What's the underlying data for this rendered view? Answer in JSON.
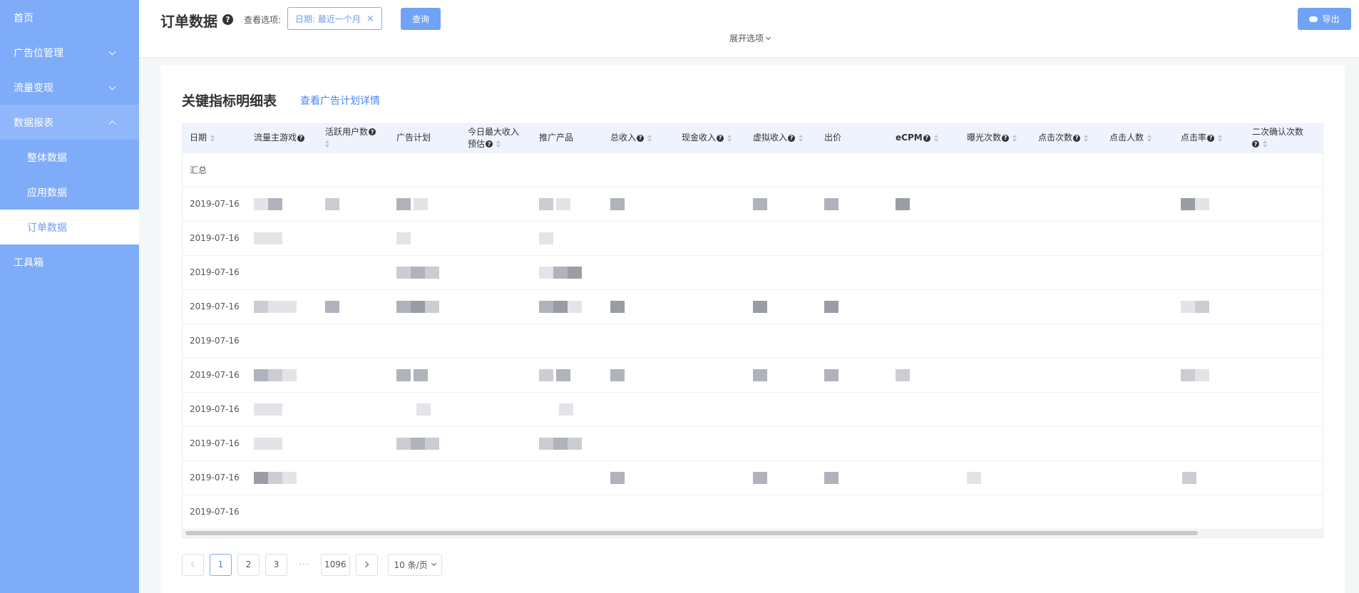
{
  "sidebar": {
    "items": [
      {
        "label": "首页"
      },
      {
        "label": "广告位管理"
      },
      {
        "label": "流量变现"
      },
      {
        "label": "数据报表"
      },
      {
        "label": "整体数据"
      },
      {
        "label": "应用数据"
      },
      {
        "label": "订单数据"
      },
      {
        "label": "工具箱"
      }
    ]
  },
  "header": {
    "title": "订单数据",
    "view_label": "查看选项:",
    "filter_tag": "日期: 最近一个月",
    "query_label": "查询",
    "expand_label": "展开选项",
    "export_label": "导出"
  },
  "card": {
    "title": "关键指标明细表",
    "detail_link": "查看广告计划详情"
  },
  "table": {
    "columns": [
      {
        "label": "日期"
      },
      {
        "label": "流量主游戏"
      },
      {
        "label": "活跃用户数"
      },
      {
        "label": "广告计划"
      },
      {
        "label": "今日最大收入预估"
      },
      {
        "label": "推广产品"
      },
      {
        "label": "总收入"
      },
      {
        "label": "现金收入"
      },
      {
        "label": "虚拟收入"
      },
      {
        "label": "出价"
      },
      {
        "label": "eCPM"
      },
      {
        "label": "曝光次数"
      },
      {
        "label": "点击次数"
      },
      {
        "label": "点击人数"
      },
      {
        "label": "点击率"
      },
      {
        "label": "二次确认次数"
      }
    ],
    "summary_label": "汇总",
    "rows": [
      {
        "date": "2019-07-16"
      },
      {
        "date": "2019-07-16"
      },
      {
        "date": "2019-07-16"
      },
      {
        "date": "2019-07-16"
      },
      {
        "date": "2019-07-16"
      },
      {
        "date": "2019-07-16"
      },
      {
        "date": "2019-07-16"
      },
      {
        "date": "2019-07-16"
      },
      {
        "date": "2019-07-16"
      },
      {
        "date": "2019-07-16"
      }
    ]
  },
  "pagination": {
    "pages": [
      "1",
      "2",
      "3"
    ],
    "ellipsis": "···",
    "last_page": "1096",
    "current_page": "1",
    "page_size": "10 条/页"
  },
  "colors": {
    "sidebar_bg": "#7facf8",
    "accent": "#6fa3f5",
    "link": "#4a86f0",
    "header_row_bg": "#eef3fe"
  },
  "icons": [
    "help-icon",
    "close-icon",
    "chevron-down-icon",
    "chevron-up-icon",
    "cloud-upload-icon",
    "sort-icon",
    "chevron-left-icon",
    "chevron-right-icon"
  ]
}
